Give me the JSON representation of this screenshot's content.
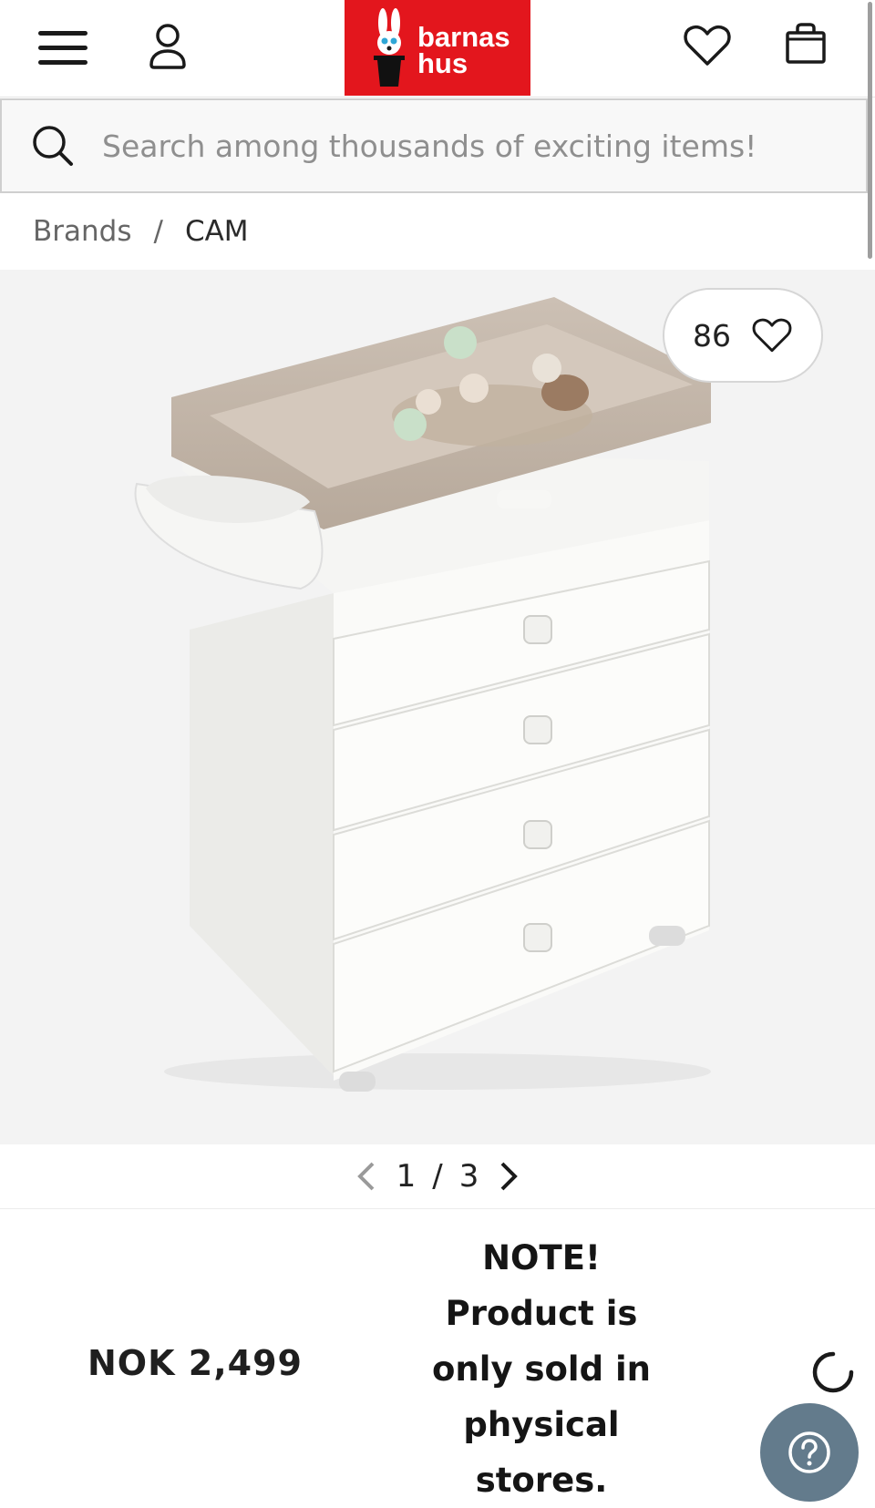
{
  "header": {
    "brand_line1": "barnas",
    "brand_line2": "hus",
    "menu_icon": "hamburger-icon",
    "account_icon": "user-icon",
    "wishlist_icon": "heart-icon",
    "cart_icon": "shopping-bag-icon",
    "brand_color": "#e3161d"
  },
  "search": {
    "placeholder": "Search among thousands of exciting items!",
    "icon": "search-icon"
  },
  "breadcrumb": {
    "items": [
      "Brands",
      "CAM"
    ],
    "separator": "/"
  },
  "product": {
    "likes": "86",
    "image_current": "1",
    "image_total": "3",
    "image_separator": "/",
    "price": "NOK 2,499",
    "note_lines": [
      "NOTE!",
      "Product is",
      "only sold in",
      "physical",
      "stores."
    ]
  },
  "help": {
    "icon": "question-icon",
    "color": "#637b8c"
  }
}
